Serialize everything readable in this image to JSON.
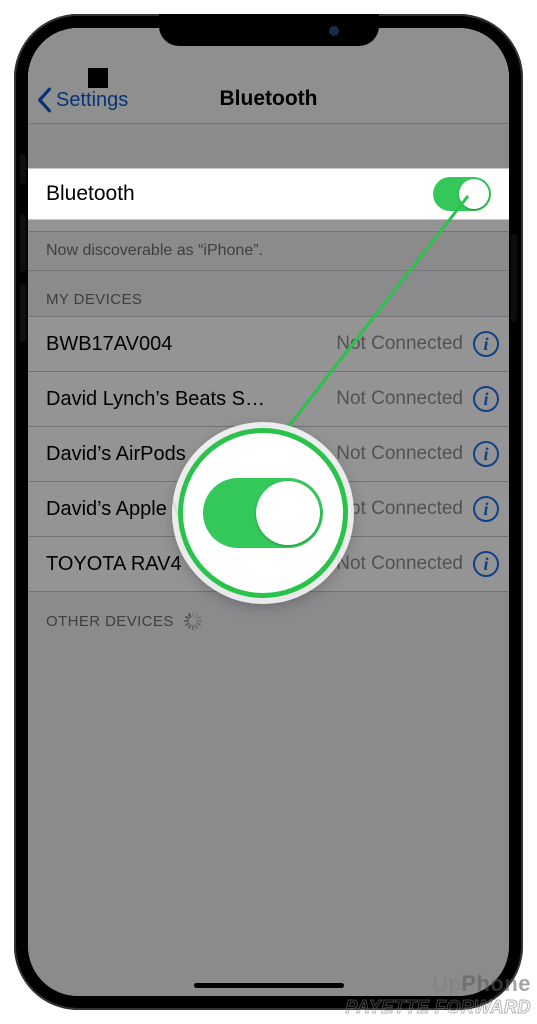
{
  "nav": {
    "back_label": "Settings",
    "title": "Bluetooth"
  },
  "bluetooth_row": {
    "label": "Bluetooth",
    "on": true
  },
  "discoverable_text": "Now discoverable as “iPhone”.",
  "sections": {
    "my_devices_header": "MY DEVICES",
    "other_devices_header": "OTHER DEVICES"
  },
  "my_devices": [
    {
      "name": "BWB17AV004",
      "status": "Not Connected"
    },
    {
      "name": "David Lynch’s Beats S…",
      "status": "Not Connected"
    },
    {
      "name": "David’s AirPods",
      "status": "Not Connected"
    },
    {
      "name": "David’s Apple Watch",
      "status": "Not Connected"
    },
    {
      "name": "TOYOTA RAV4",
      "status": "Not Connected"
    }
  ],
  "watermark": {
    "line1_prefix": "Up",
    "line1_bold": "Phone",
    "line2": "PAYETTE FORWARD"
  },
  "colors": {
    "ios_green": "#34c85a",
    "ios_blue": "#0a59d0",
    "ios_gray_text": "#8e8e93"
  }
}
